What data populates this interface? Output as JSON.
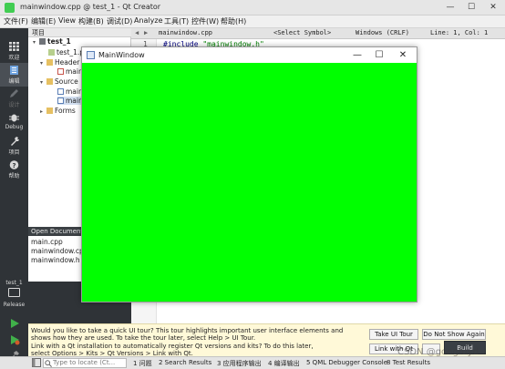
{
  "window": {
    "title": "mainwindow.cpp @ test_1 - Qt Creator",
    "controls": [
      "—",
      "☐",
      "✕"
    ]
  },
  "menubar": [
    "文件(F)",
    "编辑(E)",
    "View",
    "构建(B)",
    "调试(D)",
    "Analyze",
    "工具(T)",
    "控件(W)",
    "帮助(H)"
  ],
  "modes": [
    {
      "label": "欢迎"
    },
    {
      "label": "编辑"
    },
    {
      "label": "设计"
    },
    {
      "label": "Debug"
    },
    {
      "label": "项目"
    },
    {
      "label": "帮助"
    }
  ],
  "kit": {
    "project": "test_1",
    "config": "Release"
  },
  "project_panel": {
    "header": "项目",
    "items": [
      {
        "label": "test_1"
      },
      {
        "label": "test_1.p"
      },
      {
        "label": "Header"
      },
      {
        "label": "main"
      },
      {
        "label": "Source"
      },
      {
        "label": "main"
      },
      {
        "label": "main"
      },
      {
        "label": "Forms"
      }
    ]
  },
  "open_documents": {
    "header": "Open Documents",
    "items": [
      "main.cpp",
      "mainwindow.cpp",
      "mainwindow.h"
    ]
  },
  "editor_toolbar": {
    "file": "mainwindow.cpp",
    "symbol": "<Select Symbol>",
    "encoding": "Windows (CRLF)",
    "position": "Line: 1, Col: 1"
  },
  "editor": {
    "line_number": "1",
    "code_keyword": "#include",
    "code_string": "\"mainwindow.h\""
  },
  "app_window": {
    "title": "MainWindow",
    "controls": [
      "—",
      "☐",
      "✕"
    ],
    "background": "#00ff00"
  },
  "notification": {
    "line1": "Would you like to take a quick UI tour? This tour highlights important user interface elements and",
    "line2": "shows how they are used. To take the tour later, select Help > UI Tour.",
    "line3": "Link with a Qt installation to automatically register Qt versions and kits? To do this later,",
    "line4": "select Options > Kits > Qt Versions > Link with Qt.",
    "btn_tour": "Take UI Tour",
    "btn_dont_show": "Do Not Show Again",
    "btn_link": "Link with Qt",
    "btn_build": "Build"
  },
  "statusbar": {
    "locate_placeholder": "Type to locate (Ct...",
    "tabs": [
      "1 问题",
      "2 Search Results",
      "3 应用程序输出",
      "4 编译输出",
      "5 QML Debugger Console",
      "8 Test Results"
    ]
  },
  "watermark": "CSDN @gongfuyd",
  "colors": {
    "green": "#00ff00",
    "sidebar": "#2f3337",
    "accent": "#41cd52"
  }
}
